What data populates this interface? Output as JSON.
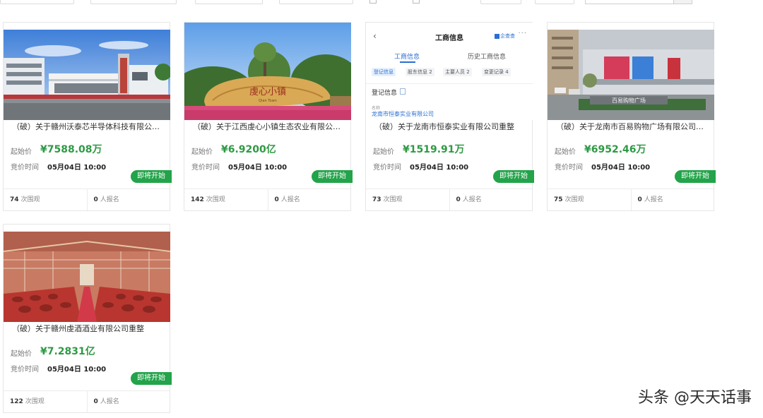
{
  "cards": [
    {
      "title": "（破）关于赣州沃泰芯半导体科技有限公司重整",
      "price_label": "起始价",
      "price": "¥7588.08万",
      "time_label": "竞价时间",
      "time": "05月04日 10:00",
      "status": "即将开始",
      "views": "74",
      "views_unit": "次围观",
      "signups": "0",
      "signups_unit": "人报名"
    },
    {
      "title": "（破）关于江西虔心小镇生态农业有限公司重整",
      "price_label": "起始价",
      "price": "¥6.9200亿",
      "time_label": "竞价时间",
      "time": "05月04日 10:00",
      "status": "即将开始",
      "views": "142",
      "views_unit": "次围观",
      "signups": "0",
      "signups_unit": "人报名",
      "photo_sign": "虔心小镇",
      "photo_sign_sub": "Qian Town"
    },
    {
      "title": "（破）关于龙南市恒泰实业有限公司重整",
      "price_label": "起始价",
      "price": "¥1519.91万",
      "time_label": "竞价时间",
      "time": "05月04日 10:00",
      "status": "即将开始",
      "views": "73",
      "views_unit": "次围观",
      "signups": "0",
      "signups_unit": "人报名",
      "snapshot": {
        "back": "‹",
        "title": "工商信息",
        "brand": "企查查",
        "more": "···",
        "tabs": [
          "工商信息",
          "历史工商信息"
        ],
        "pills": [
          "登记信息",
          "股东信息 2",
          "主要人员 2",
          "变更记录 4"
        ],
        "section": "登记信息",
        "name_label": "名称",
        "name_value": "龙南市恒泰实业有限公司"
      }
    },
    {
      "title": "（破）关于龙南市百易购物广场有限公司重整",
      "price_label": "起始价",
      "price": "¥6952.46万",
      "time_label": "竞价时间",
      "time": "05月04日 10:00",
      "status": "即将开始",
      "views": "75",
      "views_unit": "次围观",
      "signups": "0",
      "signups_unit": "人报名",
      "photo_sign": "百易购物广场"
    },
    {
      "title": "（破）关于赣州虔酒酒业有限公司重整",
      "price_label": "起始价",
      "price": "¥7.2831亿",
      "time_label": "竞价时间",
      "time": "05月04日 10:00",
      "status": "即将开始",
      "views": "122",
      "views_unit": "次围观",
      "signups": "0",
      "signups_unit": "人报名"
    }
  ],
  "watermark": "头条 @天天话事"
}
